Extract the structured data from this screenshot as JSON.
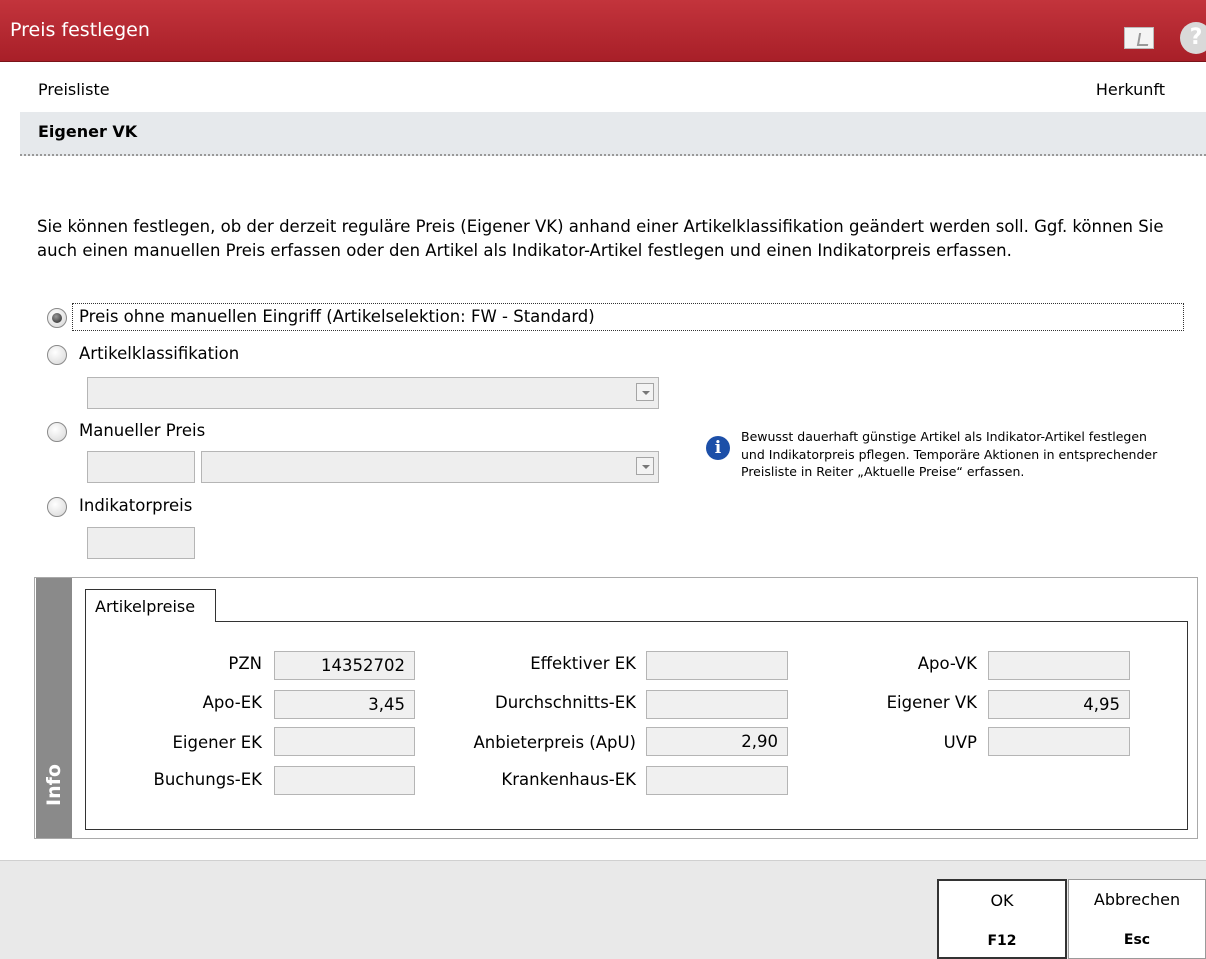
{
  "window": {
    "title": "Preis festlegen"
  },
  "header": {
    "left": "Preisliste",
    "right": "Herkunft"
  },
  "selected_row": {
    "label": "Eigener VK"
  },
  "description": "Sie können festlegen, ob der derzeit reguläre Preis (Eigener VK) anhand einer Artikelklassifikation geändert werden soll. Ggf. können Sie auch einen manuellen Preis erfassen oder den Artikel als Indikator-Artikel festlegen und einen Indikatorpreis erfassen.",
  "options": {
    "opt1": "Preis ohne manuellen Eingriff (Artikelselektion: FW - Standard)",
    "opt2": "Artikelklassifikation",
    "opt3": "Manueller Preis",
    "opt4": "Indikatorpreis",
    "selected": "opt1"
  },
  "hint": "Bewusst dauerhaft günstige Artikel als Indikator-Artikel festlegen und Indikatorpreis pflegen. Temporäre Aktionen in entsprechender Preisliste in Reiter „Aktuelle Preise“ erfassen.",
  "info_panel": {
    "strip_label": "Info",
    "tab_label": "Artikelpreise",
    "col1": [
      {
        "label": "PZN",
        "value": "14352702"
      },
      {
        "label": "Apo-EK",
        "value": "3,45"
      },
      {
        "label": "Eigener EK",
        "value": ""
      },
      {
        "label": "Buchungs-EK",
        "value": ""
      }
    ],
    "col2": [
      {
        "label": "Effektiver EK",
        "value": ""
      },
      {
        "label": "Durchschnitts-EK",
        "value": ""
      },
      {
        "label": "Anbieterpreis (ApU)",
        "value": "2,90"
      },
      {
        "label": "Krankenhaus-EK",
        "value": ""
      }
    ],
    "col3": [
      {
        "label": "Apo-VK",
        "value": ""
      },
      {
        "label": "Eigener VK",
        "value": "4,95"
      },
      {
        "label": "UVP",
        "value": ""
      }
    ]
  },
  "buttons": {
    "ok_label": "OK",
    "ok_key": "F12",
    "cancel_label": "Abbrechen",
    "cancel_key": "Esc"
  },
  "colors": {
    "titlebar": "#b3262e",
    "info_icon": "#1c4fa8",
    "strip": "#8a8a8a"
  }
}
